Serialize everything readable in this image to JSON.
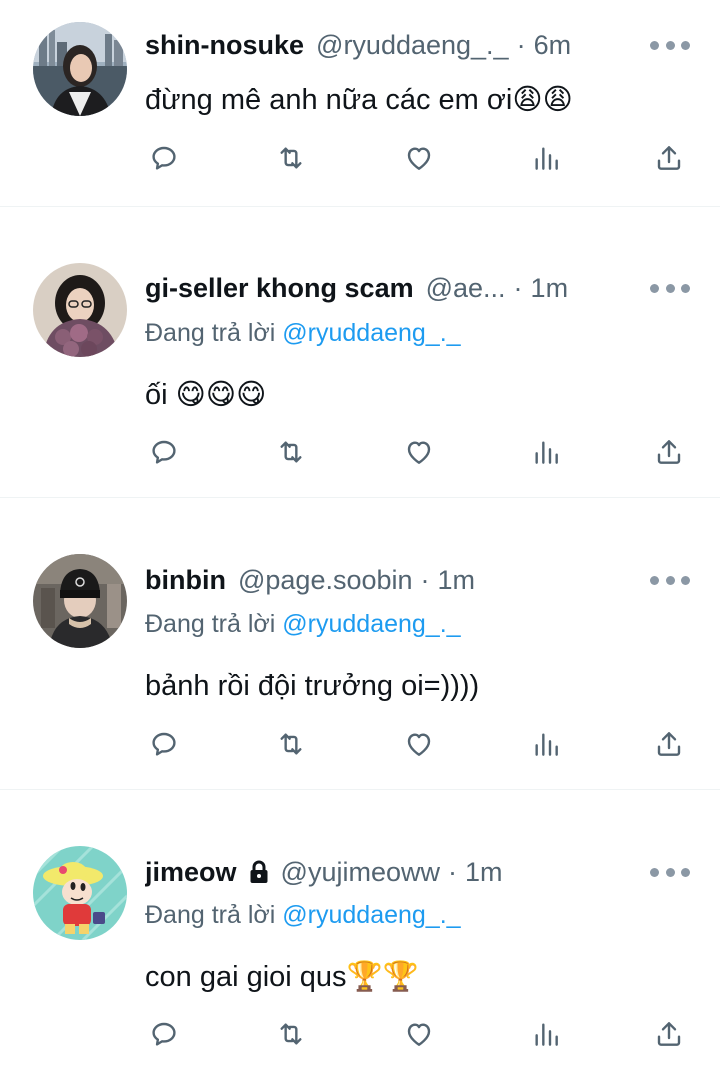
{
  "tweets": [
    {
      "name": "shin-nosuke",
      "handle": "@ryuddaeng_._",
      "dot": "·",
      "time": "6m",
      "text": "đừng mê anh nữa các em ơi😩😩",
      "avatar": "avatar-photo-girl-city"
    },
    {
      "name": "gi-seller khong scam",
      "handle": "@ae...",
      "dot": "·",
      "time": "1m",
      "reply_prefix": "Đang trả lời ",
      "reply_handle": "@ryuddaeng_._",
      "text": "ối 😋😋😋",
      "avatar": "avatar-photo-girl-flowers"
    },
    {
      "name": "binbin",
      "handle": "@page.soobin",
      "dot": "·",
      "time": "1m",
      "reply_prefix": "Đang trả lời ",
      "reply_handle": "@ryuddaeng_._",
      "text": "bảnh rồi đội trưởng oi=))))",
      "avatar": "avatar-photo-beanie"
    },
    {
      "name": "jimeow",
      "handle": "@yujimeoww",
      "dot": "·",
      "time": "1m",
      "reply_prefix": "Đang trả lời ",
      "reply_handle": "@ryuddaeng_._",
      "text": "con gai gioi qus🏆🏆",
      "avatar": "avatar-cartoon-shinchan",
      "protected": true
    }
  ],
  "colors": {
    "text": "#0f1419",
    "secondary": "#536471",
    "link": "#1d9bf0",
    "divider": "#eff3f4",
    "icon": "#536471"
  }
}
